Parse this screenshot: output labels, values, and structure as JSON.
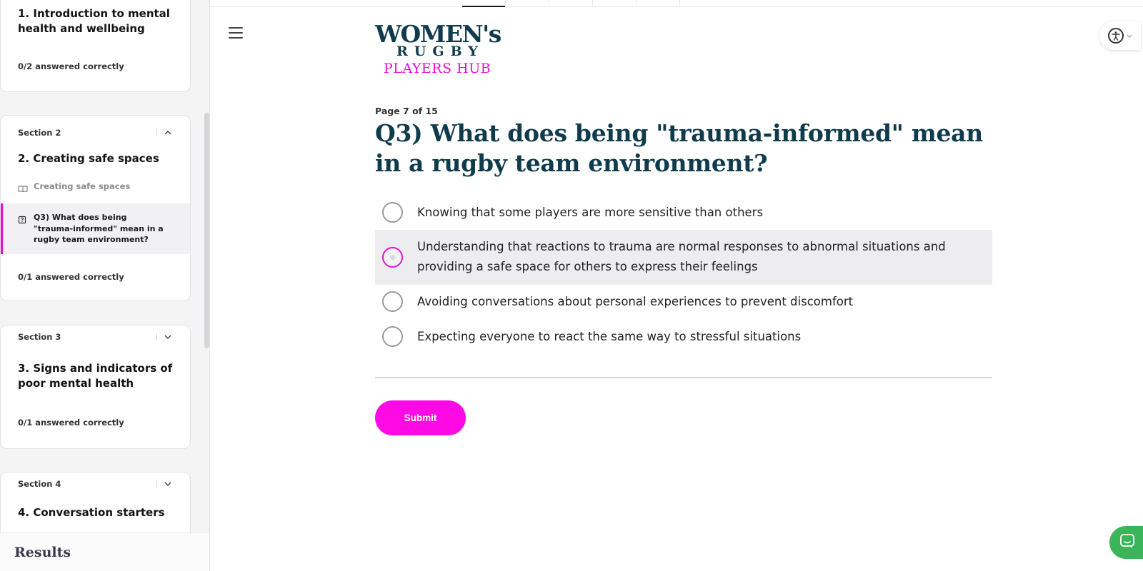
{
  "sidebar": {
    "sections": [
      {
        "title": "1. Introduction to mental health and wellbeing",
        "answered": "0/2 answered correctly"
      },
      {
        "label": "Section 2",
        "title": "2. Creating safe spaces",
        "lessons": [
          {
            "label": "Creating safe spaces",
            "icon": "book-icon"
          },
          {
            "label": "Q3) What does being \"trauma-informed\" mean in a rugby team environment?",
            "icon": "quiz-icon"
          }
        ],
        "answered": "0/1 answered correctly"
      },
      {
        "label": "Section 3",
        "title": "3. Signs and indicators of poor mental health",
        "answered": "0/1 answered correctly"
      },
      {
        "label": "Section 4",
        "title": "4. Conversation starters"
      }
    ],
    "results_label": "Results"
  },
  "logo": {
    "line1": "WOMEN's",
    "line2": "RUGBY",
    "line3": "PLAYERS HUB"
  },
  "quiz": {
    "page": "Page 7 of 15",
    "question": "Q3) What does being \"trauma-informed\" mean in a rugby team environment?",
    "options": [
      "Knowing that some players are more sensitive than others",
      "Understanding that reactions to trauma are normal responses to abnormal situations and providing a safe space for others to express their feelings",
      "Avoiding conversations about personal experiences to prevent discomfort",
      "Expecting everyone to react the same way to stressful situations"
    ],
    "selected_index": 1,
    "submit_label": "Submit"
  },
  "colors": {
    "accent": "#ff0ae4",
    "brand_navy": "#0f3b4d",
    "chat_green": "#3cb55a"
  },
  "icons": {
    "menu": "hamburger-menu-icon",
    "accessibility": "accessibility-icon",
    "chat": "chat-icon"
  }
}
